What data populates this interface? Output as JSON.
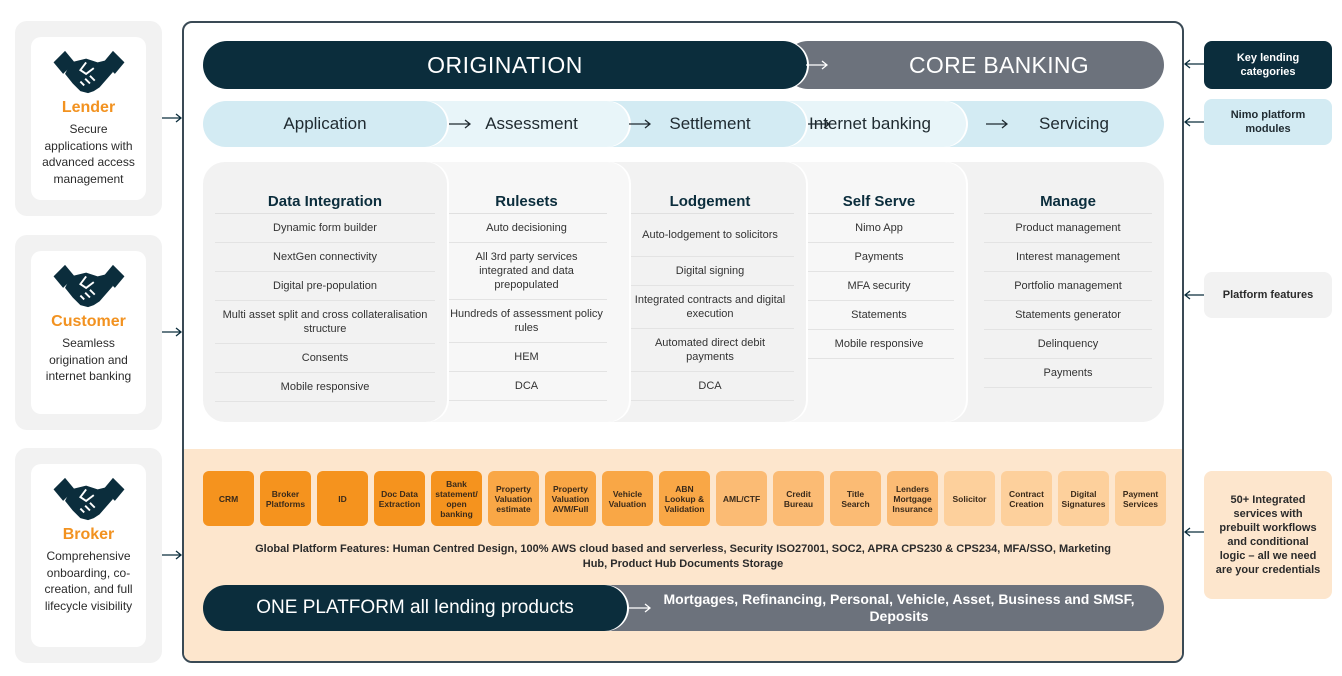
{
  "personas": [
    {
      "title": "Lender",
      "description": "Secure applications with advanced access management",
      "icon": "handshake-icon"
    },
    {
      "title": "Customer",
      "description": "Seamless origination and internet banking",
      "icon": "handshake-icon"
    },
    {
      "title": "Broker",
      "description": "Comprehensive onboarding, co-creation, and full lifecycle visibility",
      "icon": "handshake-icon"
    }
  ],
  "categories": {
    "origination": "ORIGINATION",
    "core_banking": "CORE BANKING"
  },
  "modules": [
    "Application",
    "Assessment",
    "Settlement",
    "Internet banking",
    "Servicing"
  ],
  "feature_columns": [
    {
      "heading": "Data Integration",
      "items": [
        "Dynamic form builder",
        "NextGen connectivity",
        "Digital pre-population",
        "Multi asset split and cross collateralisation structure",
        "Consents",
        "Mobile responsive"
      ]
    },
    {
      "heading": "Rulesets",
      "items": [
        "Auto decisioning",
        "All 3rd party services integrated and data prepopulated",
        "Hundreds of assessment policy rules",
        "HEM",
        "DCA"
      ]
    },
    {
      "heading": "Lodgement",
      "items": [
        "Auto-lodgement to solicitors",
        "Digital signing",
        "Integrated contracts and digital execution",
        "Automated direct debit payments",
        "DCA"
      ]
    },
    {
      "heading": "Self Serve",
      "items": [
        "Nimo App",
        "Payments",
        "MFA security",
        "Statements",
        "Mobile responsive"
      ]
    },
    {
      "heading": "Manage",
      "items": [
        "Product management",
        "Interest management",
        "Portfolio management",
        "Statements generator",
        "Delinquency",
        "Payments"
      ]
    }
  ],
  "services": [
    {
      "label": "CRM",
      "color": "#f5931e"
    },
    {
      "label": "Broker Platforms",
      "color": "#f5931e"
    },
    {
      "label": "ID",
      "color": "#f5931e"
    },
    {
      "label": "Doc Data Extraction",
      "color": "#f5931e"
    },
    {
      "label": "Bank statement/ open banking",
      "color": "#f5931e"
    },
    {
      "label": "Property Valuation estimate",
      "color": "#f9a746"
    },
    {
      "label": "Property Valuation AVM/Full",
      "color": "#f9a746"
    },
    {
      "label": "Vehicle Valuation",
      "color": "#f9a746"
    },
    {
      "label": "ABN Lookup & Validation",
      "color": "#f9a746"
    },
    {
      "label": "AML/CTF",
      "color": "#fbbb74"
    },
    {
      "label": "Credit Bureau",
      "color": "#fbbb74"
    },
    {
      "label": "Title Search",
      "color": "#fbbb74"
    },
    {
      "label": "Lenders Mortgage Insurance",
      "color": "#fbbb74"
    },
    {
      "label": "Solicitor",
      "color": "#fdd09c"
    },
    {
      "label": "Contract Creation",
      "color": "#fdd09c"
    },
    {
      "label": "Digital Signatures",
      "color": "#fdd09c"
    },
    {
      "label": "Payment Services",
      "color": "#fdd09c"
    }
  ],
  "global_features": "Global Platform Features: Human Centred Design, 100% AWS cloud based and serverless, Security ISO27001, SOC2, APRA CPS230 & CPS234, MFA/SSO, Marketing Hub, Product Hub Documents Storage",
  "platform": {
    "one_platform": "ONE PLATFORM all lending products",
    "products": "Mortgages,  Refinancing, Personal, Vehicle, Asset, Business and SMSF, Deposits"
  },
  "legend": [
    {
      "label": "Key lending categories",
      "bg": "#0b2d3c",
      "fg": "#ffffff"
    },
    {
      "label": "Nimo platform modules",
      "bg": "#d3ebf3",
      "fg": "#1f2a30"
    },
    {
      "label": "Platform features",
      "bg": "#f2f2f2",
      "fg": "#2b2b2b"
    },
    {
      "label": "50+ Integrated services with prebuilt workflows and conditional logic – all we need are your credentials",
      "bg": "#fde6cd",
      "fg": "#2b2b2b"
    }
  ],
  "colors": {
    "navy": "#0b2d3c",
    "slate": "#6c727c",
    "accent_orange": "#f29220",
    "module_blue": "#d3ebf3",
    "peach": "#fde6cd"
  }
}
